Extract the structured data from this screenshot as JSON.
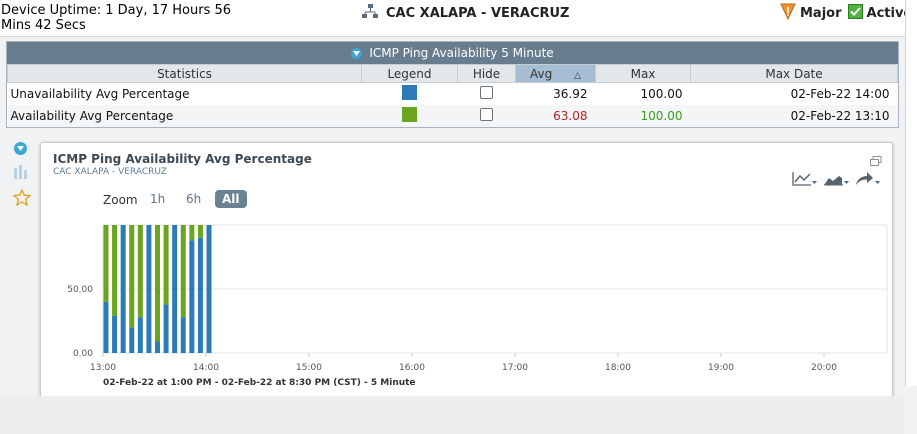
{
  "header": {
    "uptime": "Device Uptime: 1 Day, 17 Hours 56 Mins 42 Secs",
    "device_name": "CAC XALAPA - VERACRUZ",
    "severity": "Major",
    "state": "Active"
  },
  "stats": {
    "title": "ICMP Ping Availability 5 Minute",
    "columns": [
      "Statistics",
      "Legend",
      "Hide",
      "Avg",
      "Max",
      "Max Date"
    ],
    "rows": [
      {
        "name": "Unavailability Avg Percentage",
        "color": "#2c7bb6",
        "hidden": false,
        "avg": "36.92",
        "max": "100.00",
        "max_date": "02-Feb-22 14:00"
      },
      {
        "name": "Availability Avg Percentage",
        "color": "#69a51e",
        "hidden": false,
        "avg": "63.08",
        "max": "100.00",
        "max_date": "02-Feb-22 13:10"
      }
    ]
  },
  "chart": {
    "title": "ICMP Ping Availability Avg Percentage",
    "subtitle": "CAC XALAPA - VERACRUZ",
    "zoom_label": "Zoom",
    "zoom_options": [
      "1h",
      "6h",
      "All"
    ],
    "zoom_selected": "All",
    "footer": "02-Feb-22 at 1:00 PM - 02-Feb-22 at 8:30 PM (CST) - 5 Minute"
  },
  "chart_data": {
    "type": "bar",
    "stacked": true,
    "categories": [
      "13:00",
      "13:05",
      "13:10",
      "13:15",
      "13:20",
      "13:25",
      "13:30",
      "13:35",
      "13:40",
      "13:45",
      "13:50",
      "13:55",
      "14:00"
    ],
    "series": [
      {
        "name": "Unavailability Avg Percentage",
        "color": "#2c7bb6",
        "values": [
          40,
          29,
          100,
          20,
          28,
          100,
          9,
          38,
          100,
          28,
          88,
          90,
          100
        ]
      },
      {
        "name": "Availability Avg Percentage",
        "color": "#69a51e",
        "values": [
          60,
          71,
          0,
          80,
          72,
          0,
          91,
          62,
          0,
          72,
          12,
          10,
          0
        ]
      }
    ],
    "x_tick_labels": [
      "13:00",
      "14:00",
      "15:00",
      "16:00",
      "17:00",
      "18:00",
      "19:00",
      "20:00"
    ],
    "x_range": [
      "13:00",
      "20:30"
    ],
    "y_tick_labels": [
      "0.00",
      "50.00"
    ],
    "ylim": [
      0,
      100
    ],
    "grid": true
  }
}
